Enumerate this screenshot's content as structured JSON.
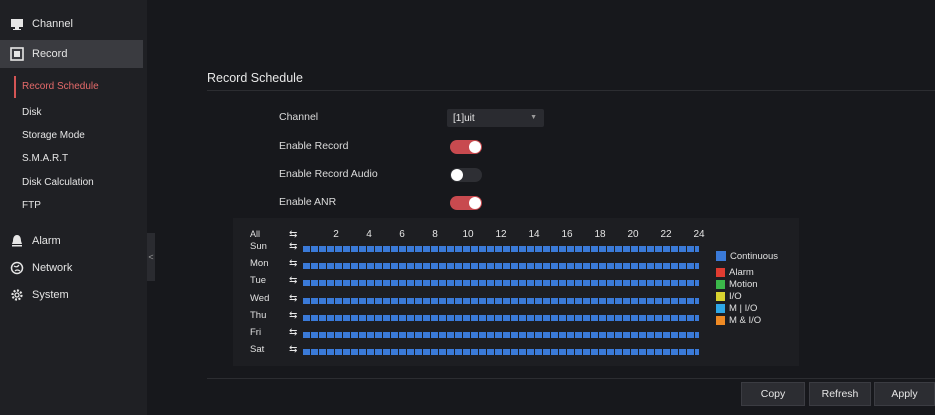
{
  "sidebar": {
    "channel": "Channel",
    "record": "Record",
    "record_sub": [
      "Record Schedule",
      "Disk",
      "Storage Mode",
      "S.M.A.R.T",
      "Disk Calculation",
      "FTP"
    ],
    "alarm": "Alarm",
    "network": "Network",
    "system": "System",
    "collapse": "<"
  },
  "page": {
    "title": "Record Schedule",
    "channel_label": "Channel",
    "channel_value": "[1]uit",
    "enable_record_label": "Enable Record",
    "enable_record": true,
    "enable_audio_label": "Enable Record Audio",
    "enable_audio": false,
    "enable_anr_label": "Enable ANR",
    "enable_anr": true
  },
  "schedule": {
    "all_label": "All",
    "hours": [
      "2",
      "4",
      "6",
      "8",
      "10",
      "12",
      "14",
      "16",
      "18",
      "20",
      "22",
      "24"
    ],
    "days": [
      "Sun",
      "Mon",
      "Tue",
      "Wed",
      "Thu",
      "Fri",
      "Sat"
    ],
    "swap_glyph": "⇆",
    "legend": [
      {
        "label": "Continuous",
        "color": "#3a7ad8"
      },
      {
        "label": "Alarm",
        "color": "#e03c31"
      },
      {
        "label": "Motion",
        "color": "#3bb84a"
      },
      {
        "label": "I/O",
        "color": "#d8d230"
      },
      {
        "label": "M | I/O",
        "color": "#2fa8e6"
      },
      {
        "label": "M & I/O",
        "color": "#ef8a24"
      }
    ]
  },
  "buttons": {
    "copy": "Copy",
    "refresh": "Refresh",
    "apply": "Apply"
  }
}
